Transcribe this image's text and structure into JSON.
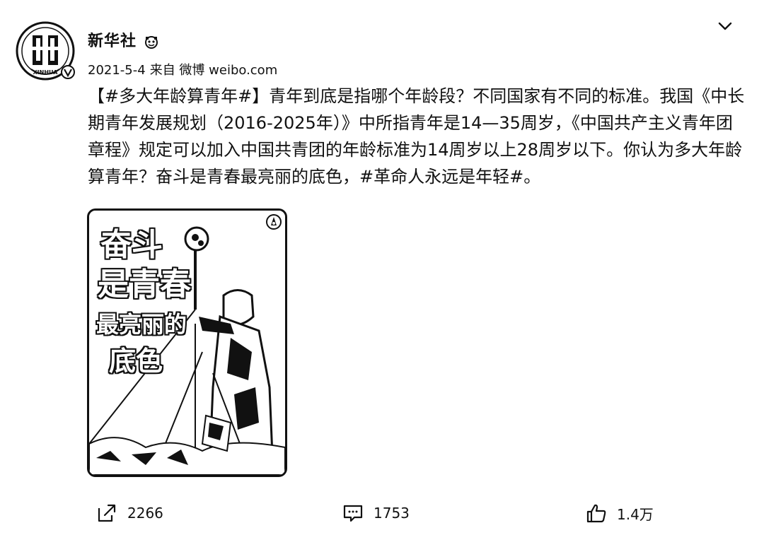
{
  "post": {
    "user": {
      "name": "新华社",
      "avatar_icon": "xinhua-logo",
      "avatar_text": "XINHUA",
      "verified_icon": "verified-badge-icon",
      "badge_icon": "member-badge-icon"
    },
    "date": "2021-5-4",
    "source": "来自 微博 weibo.com",
    "text": "【#多大年龄算青年#】青年到底是指哪个年龄段？不同国家有不同的标准。我国《中长期青年发展规划（2016-2025年）》中所指青年是14—35周岁，《中国共产主义青年团章程》规定可以加入中国共青团的年龄标准为14周岁以上28周岁以下。你认为多大年龄算青年？奋斗是青春最亮丽的底色，#革命人永远是年轻#。",
    "image": {
      "lines": [
        "奋斗",
        "是青春",
        "最亮丽的",
        "底色"
      ],
      "corner_icon": "league-emblem-icon"
    },
    "actions": {
      "repost": {
        "icon": "share-icon",
        "count": "2266"
      },
      "comment": {
        "icon": "comment-icon",
        "count": "1753"
      },
      "like": {
        "icon": "thumbs-up-icon",
        "count": "1.4万"
      }
    }
  },
  "colors": {
    "text": "#111111",
    "background": "#ffffff"
  }
}
